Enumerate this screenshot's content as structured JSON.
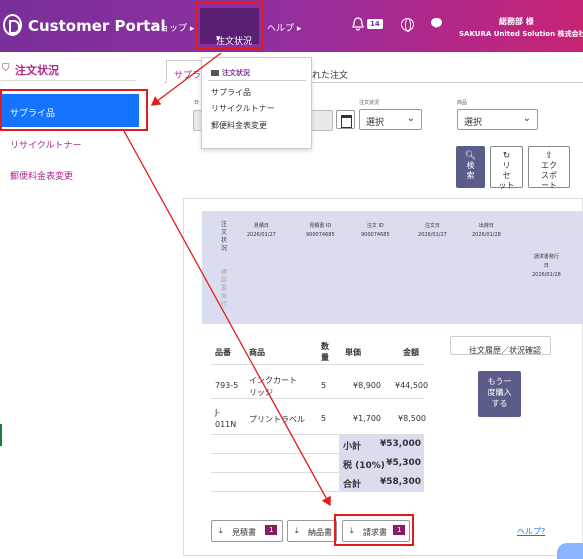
{
  "header": {
    "brand": "Customer Portal",
    "nav": [
      "ショップ",
      "注文状況",
      "ヘルプ"
    ],
    "notification_count": "14",
    "user_name": "総務部 様",
    "user_company": "SAKURA United Solution 株式会社"
  },
  "dropdown": {
    "title": "注文状況",
    "items": [
      "サプライ品",
      "リサイクルトナー",
      "郵便料金表変更"
    ]
  },
  "sidebar": {
    "title": "注文状況",
    "items": [
      "サプライ品",
      "リサイクルトナー",
      "郵便料金表変更"
    ]
  },
  "tabs": [
    "サプラ",
    "れた注文"
  ],
  "filters": {
    "status_label": "注文状況",
    "status_value": "選択",
    "product_label": "商品",
    "product_value": "選択",
    "date_label": "日"
  },
  "buttons": {
    "search": [
      "検",
      "索"
    ],
    "reset": [
      "リ",
      "セ",
      "ット"
    ],
    "export": [
      "エク",
      "スポ",
      "ート"
    ]
  },
  "order_header": {
    "vertical_label": "注文状況",
    "vertical_label_faint": "確認要発行",
    "columns": [
      {
        "label": "見積日",
        "value": "2026/01/27"
      },
      {
        "label": "見積書 ID",
        "value": "900074685"
      },
      {
        "label": "注文 ID",
        "value": "900074685"
      },
      {
        "label": "注文日",
        "value": "2026/01/27"
      },
      {
        "label": "出荷日",
        "value": "2026/01/28"
      }
    ],
    "invoice_label": [
      "請求書発行",
      "日"
    ],
    "invoice_date": "2026/01/28"
  },
  "items_table": {
    "headers": [
      "品番",
      "商品",
      "数量",
      "単価",
      "金額"
    ],
    "rows": [
      {
        "code": "793-5",
        "name": "インクカートリッジ",
        "qty": "5",
        "unit": "¥8,900",
        "amount": "¥44,500"
      },
      {
        "code_lines": [
          "J-",
          "011N"
        ],
        "name": "プリントラベル",
        "qty": "5",
        "unit": "¥1,700",
        "amount": "¥8,500"
      }
    ],
    "subtotal_label": "小計",
    "subtotal": "¥53,000",
    "tax_label": "税 (10%)",
    "tax": "¥5,300",
    "total_label": "合計",
    "total": "¥58,300"
  },
  "actions": {
    "history": "注文履歴／状況確認",
    "rebuy": [
      "もう一",
      "度購入",
      "する"
    ]
  },
  "documents": [
    {
      "label": "見積書",
      "count": "1"
    },
    {
      "label": "納品書",
      "count": ""
    },
    {
      "label": "請求書",
      "count": "1"
    }
  ],
  "help_link": "ヘルプ?",
  "colors": {
    "brand_purple": "#7a2f99",
    "brand_magenta": "#c72474",
    "active_blue": "#1574ff",
    "button_slate": "#5b5c8a",
    "annotation_red": "#e21c1c"
  }
}
